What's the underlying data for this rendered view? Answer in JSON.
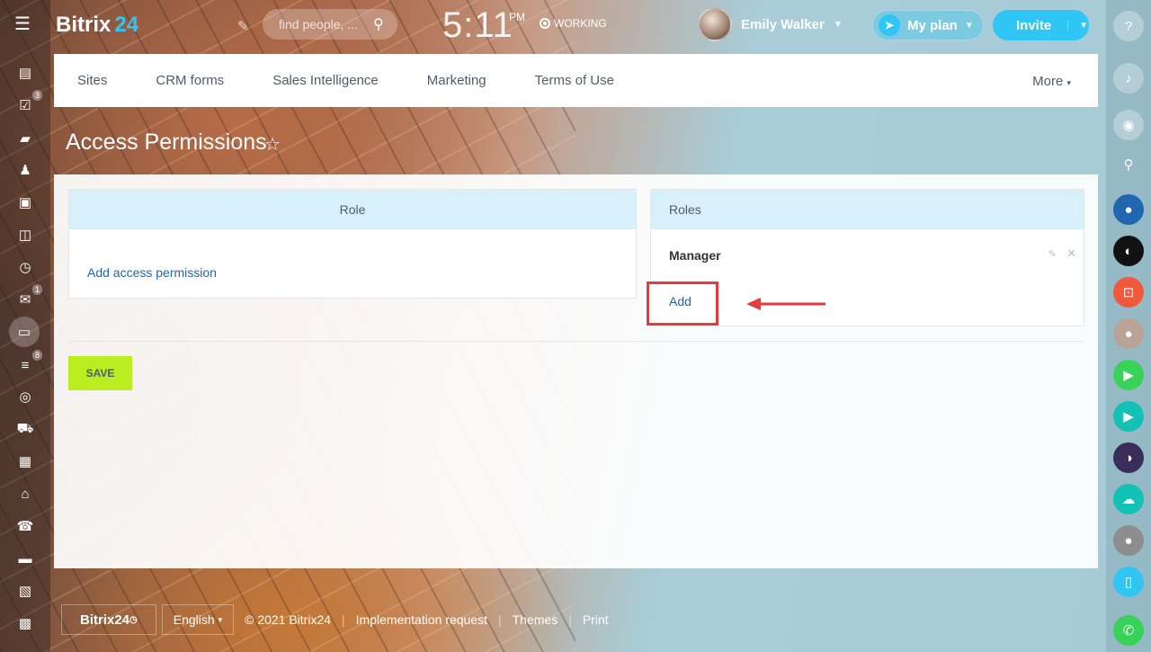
{
  "header": {
    "logo_text": "Bitrix",
    "logo_num": "24",
    "search_placeholder": "find people, ...",
    "time": "5:11",
    "ampm": "PM",
    "work_status": "WORKING",
    "user_name": "Emily Walker",
    "myplan_label": "My plan",
    "invite_label": "Invite"
  },
  "left_sidebar": {
    "counters": {
      "tasks": "3",
      "mail": "1",
      "filter": "8"
    }
  },
  "nav": {
    "items": [
      "Sites",
      "CRM forms",
      "Sales Intelligence",
      "Marketing",
      "Terms of Use"
    ],
    "more_label": "More"
  },
  "page": {
    "title": "Access Permissions"
  },
  "role_panel": {
    "header": "Role",
    "add_permission_label": "Add access permission"
  },
  "roles_panel": {
    "header": "Roles",
    "role_name": "Manager",
    "add_label": "Add"
  },
  "actions": {
    "save_label": "SAVE"
  },
  "footer": {
    "logo": "Bitrix24",
    "language": "English",
    "copyright": "© 2021 Bitrix24",
    "links": [
      "Implementation request",
      "Themes",
      "Print"
    ]
  },
  "colors": {
    "accent": "#2fc6f6",
    "save_button": "#bbed21",
    "highlight": "#e8393d",
    "link": "#2067b0"
  }
}
